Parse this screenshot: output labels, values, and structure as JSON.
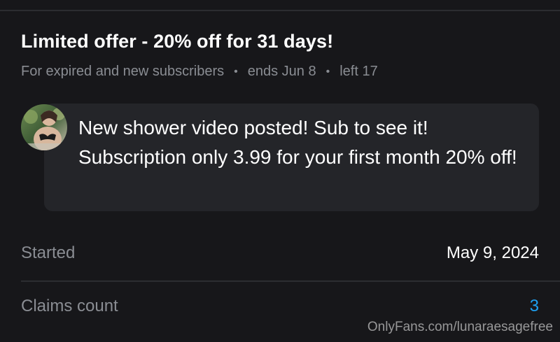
{
  "offer": {
    "title": "Limited offer - 20% off for 31 days!",
    "audience": "For expired and new subscribers",
    "ends": "ends Jun 8",
    "left": "left 17",
    "separator": "•"
  },
  "message": {
    "text": "New shower video posted! Sub to see it! Subscription only 3.99 for your first month 20% off!"
  },
  "details": {
    "started_label": "Started",
    "started_value": "May 9, 2024",
    "claims_label": "Claims count",
    "claims_value": "3"
  },
  "watermark": "OnlyFans.com/lunaraesagefree",
  "colors": {
    "background": "#17171a",
    "bubble": "#242529",
    "muted_text": "#8a8d93",
    "accent": "#1ea1f2"
  }
}
